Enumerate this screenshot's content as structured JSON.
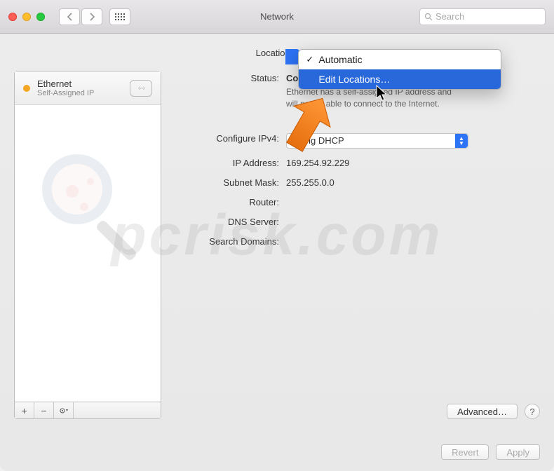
{
  "window": {
    "title": "Network"
  },
  "search": {
    "placeholder": "Search"
  },
  "location": {
    "label": "Location:",
    "options": {
      "automatic": "Automatic",
      "edit": "Edit Locations…"
    }
  },
  "sidebar": {
    "service": {
      "name": "Ethernet",
      "status": "Self-Assigned IP"
    },
    "buttons": {
      "add": "+",
      "remove": "−",
      "gear": "✻▾"
    }
  },
  "details": {
    "status_label": "Status:",
    "status_value": "Connected",
    "status_desc1": "Ethernet has a self-assigned IP address and",
    "status_desc2": "will not be able to connect to the Internet.",
    "configure_label": "Configure IPv4:",
    "configure_value": "Using DHCP",
    "ip_label": "IP Address:",
    "ip_value": "169.254.92.229",
    "subnet_label": "Subnet Mask:",
    "subnet_value": "255.255.0.0",
    "router_label": "Router:",
    "router_value": "",
    "dns_label": "DNS Server:",
    "dns_value": "",
    "domains_label": "Search Domains:",
    "domains_value": ""
  },
  "buttons": {
    "advanced": "Advanced…",
    "help": "?",
    "revert": "Revert",
    "apply": "Apply"
  },
  "watermark": "pcrisk.com"
}
